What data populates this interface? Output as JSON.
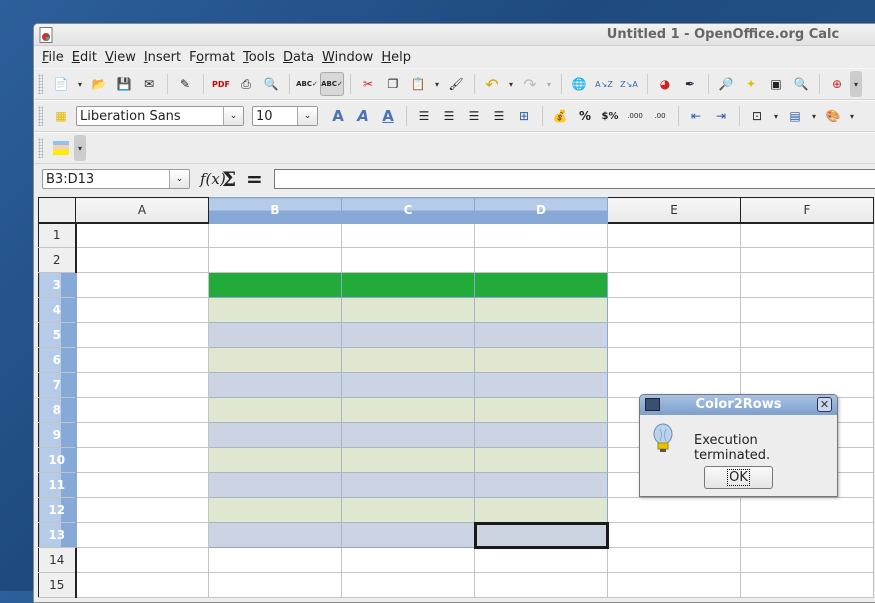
{
  "window": {
    "title": "Untitled 1 - OpenOffice.org Calc"
  },
  "menu": [
    "File",
    "Edit",
    "View",
    "Insert",
    "Format",
    "Tools",
    "Data",
    "Window",
    "Help"
  ],
  "menu_mnemonics": [
    "F",
    "E",
    "V",
    "I",
    "o",
    "T",
    "D",
    "W",
    "H"
  ],
  "formatting": {
    "font_name": "Liberation Sans",
    "font_size": "10"
  },
  "formula_bar": {
    "name_box": "B3:D13",
    "fx_label": "f(x)",
    "sum_label": "Σ",
    "equals_label": "=",
    "content": ""
  },
  "sheet": {
    "columns": [
      "A",
      "B",
      "C",
      "D",
      "E",
      "F"
    ],
    "selected_columns": [
      "B",
      "C",
      "D"
    ],
    "rows": [
      "1",
      "2",
      "3",
      "4",
      "5",
      "6",
      "7",
      "8",
      "9",
      "10",
      "11",
      "12",
      "13",
      "14",
      "15"
    ],
    "selected_rows": [
      "3",
      "4",
      "5",
      "6",
      "7",
      "8",
      "9",
      "10",
      "11",
      "12",
      "13"
    ],
    "selection": "B3:D13",
    "active_cell": "D13",
    "colors": {
      "header_row": "#22aa3a",
      "even_band": "#dfe7d0",
      "odd_band": "#ccd4e3"
    }
  },
  "dialog": {
    "title": "Color2Rows",
    "message": "Execution terminated.",
    "ok_label": "OK"
  }
}
